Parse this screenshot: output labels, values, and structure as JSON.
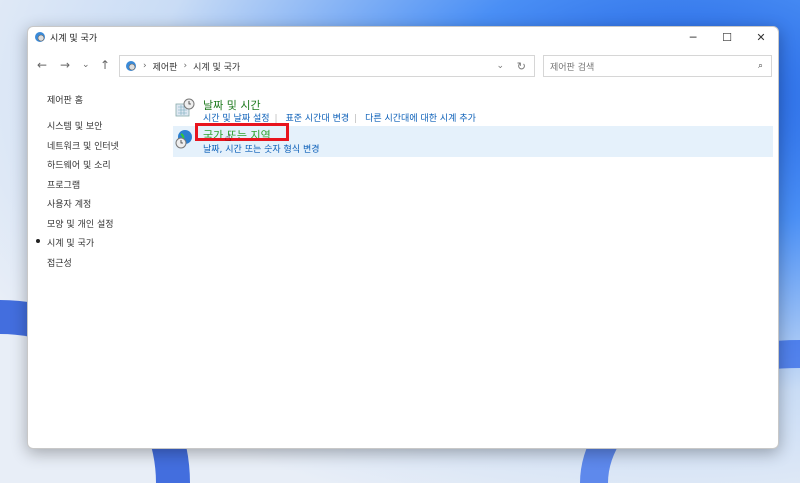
{
  "window": {
    "title": "시계 및 국가",
    "controls": {
      "minimize": "─",
      "maximize": "☐",
      "close": "✕"
    }
  },
  "nav": {
    "back": "←",
    "forward": "→",
    "recent": "⌄",
    "up": "↑"
  },
  "address": {
    "crumbs": [
      "제어판",
      "시계 및 국가"
    ],
    "refresh": "↻",
    "dropdown": "⌄"
  },
  "search": {
    "placeholder": "제어판 검색",
    "icon": "⌕"
  },
  "sidebar": {
    "home": "제어판 홈",
    "items": [
      "시스템 및 보안",
      "네트워크 및 인터넷",
      "하드웨어 및 소리",
      "프로그램",
      "사용자 계정",
      "모양 및 개인 설정",
      "시계 및 국가",
      "접근성"
    ],
    "current_index": 6
  },
  "categories": [
    {
      "title": "날짜 및 시간",
      "links": [
        "시간 및 날짜 설정",
        "표준 시간대 변경",
        "다른 시간대에 대한 시계 추가"
      ]
    },
    {
      "title": "국가 또는 지역",
      "links": [
        "날짜, 시간 또는 숫자 형식 변경"
      ]
    }
  ],
  "colors": {
    "highlight": "#e8141e",
    "link": "#0b5fb8",
    "title_green": "#1e7a1e"
  }
}
